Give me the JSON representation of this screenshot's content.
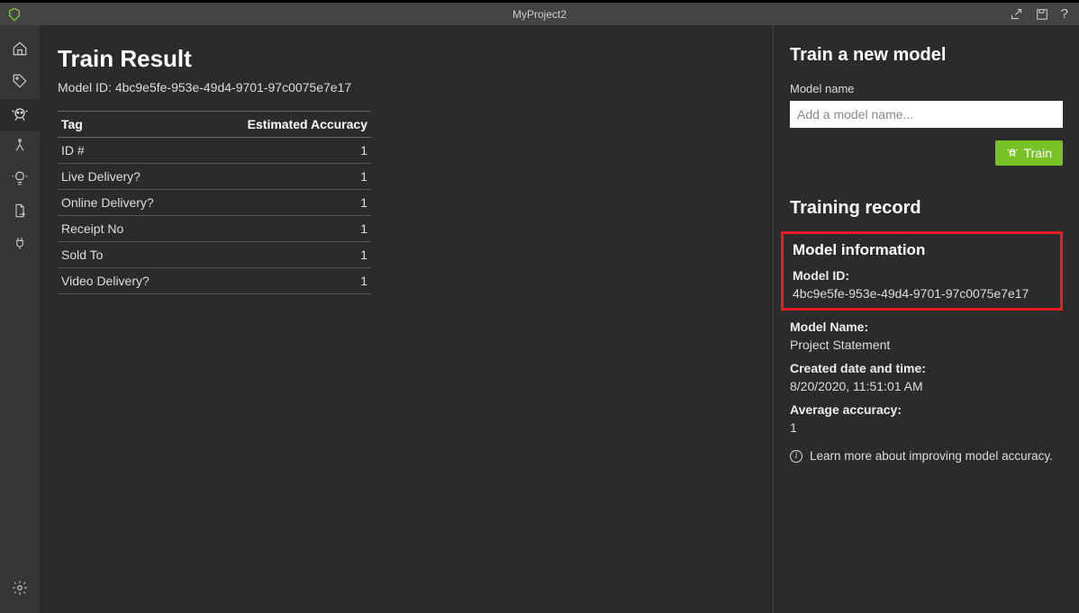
{
  "topbar": {
    "title": "MyProject2"
  },
  "sidebar": {
    "items": [
      {
        "name": "home"
      },
      {
        "name": "tags"
      },
      {
        "name": "robot"
      },
      {
        "name": "merge"
      },
      {
        "name": "lightbulb"
      },
      {
        "name": "file-export"
      },
      {
        "name": "plug"
      }
    ]
  },
  "main": {
    "title": "Train Result",
    "model_id_prefix": "Model ID: ",
    "model_id": "4bc9e5fe-953e-49d4-9701-97c0075e7e17",
    "table": {
      "headers": {
        "tag": "Tag",
        "accuracy": "Estimated Accuracy"
      },
      "rows": [
        {
          "tag": "ID #",
          "accuracy": "1"
        },
        {
          "tag": "Live Delivery?",
          "accuracy": "1"
        },
        {
          "tag": "Online Delivery?",
          "accuracy": "1"
        },
        {
          "tag": "Receipt No",
          "accuracy": "1"
        },
        {
          "tag": "Sold To",
          "accuracy": "1"
        },
        {
          "tag": "Video Delivery?",
          "accuracy": "1"
        }
      ]
    }
  },
  "panel": {
    "train_title": "Train a new model",
    "model_name_label": "Model name",
    "model_name_placeholder": "Add a model name...",
    "train_button": "Train",
    "record_title": "Training record",
    "model_info_title": "Model information",
    "model_id_label": "Model ID:",
    "model_id_value": "4bc9e5fe-953e-49d4-9701-97c0075e7e17",
    "model_name_label2": "Model Name:",
    "model_name_value": "Project Statement",
    "created_label": "Created date and time:",
    "created_value": "8/20/2020, 11:51:01 AM",
    "avg_acc_label": "Average accuracy:",
    "avg_acc_value": "1",
    "learn_more": "Learn more about improving model accuracy."
  }
}
